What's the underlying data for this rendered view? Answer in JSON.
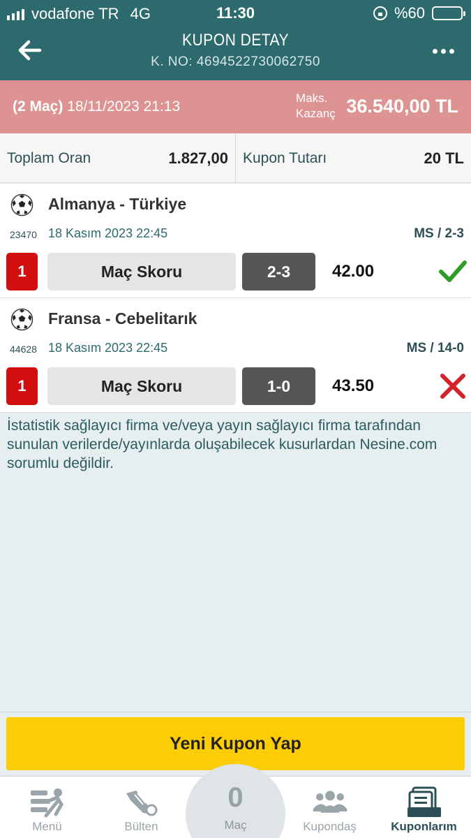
{
  "status_bar": {
    "carrier": "vodafone TR",
    "network": "4G",
    "time": "11:30",
    "battery": "%60",
    "battery_level": 0.6
  },
  "header": {
    "title": "KUPON DETAY",
    "coupon_no": "K. NO: 4694522730062750"
  },
  "summary": {
    "match_count": "(2 Maç)",
    "date": "18/11/2023 21:13",
    "max_win_label_1": "Maks.",
    "max_win_label_2": "Kazanç",
    "max_win_value": "36.540,00 TL"
  },
  "totals": {
    "total_odds_label": "Toplam Oran",
    "total_odds_value": "1.827,00",
    "amount_label": "Kupon Tutarı",
    "amount_value": "20 TL"
  },
  "matches": [
    {
      "teams": "Almanya - Türkiye",
      "event_id": "23470",
      "date": "18 Kasım 2023 22:45",
      "result": "MS / 2-3",
      "pick_no": "1",
      "market": "Maç Skoru",
      "selection": "2-3",
      "odd": "42.00",
      "won": true
    },
    {
      "teams": "Fransa - Cebelitarık",
      "event_id": "44628",
      "date": "18 Kasım 2023 22:45",
      "result": "MS / 14-0",
      "pick_no": "1",
      "market": "Maç Skoru",
      "selection": "1-0",
      "odd": "43.50",
      "won": false
    }
  ],
  "disclaimer": "İstatistik sağlayıcı firma ve/veya yayın sağlayıcı firma tarafından sunulan verilerde/yayınlarda oluşabilecek kusurlardan Nesine.com sorumlu değildir.",
  "cta_label": "Yeni Kupon Yap",
  "tabbar": {
    "menu": "Menü",
    "bulletin": "Bülten",
    "match_count": "0",
    "match": "Maç",
    "kupondas": "Kupondaş",
    "coupons": "Kuponlarım"
  },
  "colors": {
    "header": "#2d6a6d",
    "summary": "#de9393",
    "cta": "#fccc04",
    "win": "#2e9d27",
    "lose": "#d3222a"
  },
  "icons": [
    "back-arrow-icon",
    "more-icon",
    "soccer-ball-icon",
    "check-icon",
    "cross-icon",
    "menu-icon",
    "bulletin-icon",
    "kupondas-icon",
    "coupons-icon"
  ]
}
